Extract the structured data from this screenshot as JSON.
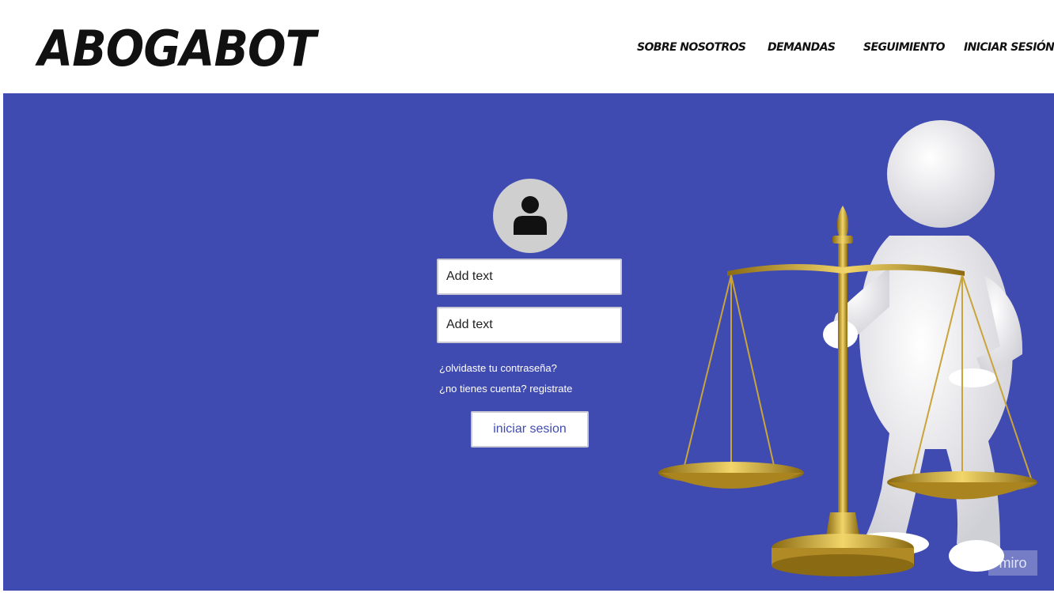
{
  "header": {
    "logo": "ABOGABOT",
    "nav": [
      {
        "label": "SOBRE NOSOTROS"
      },
      {
        "label": "DEMANDAS"
      },
      {
        "label": "SEGUIMIENTO"
      },
      {
        "label": "INICIAR SESIÓN"
      }
    ]
  },
  "login": {
    "avatar_icon": "user-icon",
    "field1_placeholder": "Add text",
    "field2_placeholder": "Add text",
    "forgot_link": "¿olvidaste tu contraseña?",
    "register_link": "¿no tienes cuenta? registrate",
    "submit_label": "iniciar sesion"
  },
  "watermark": "miro",
  "colors": {
    "hero_background": "#404bb2",
    "header_background": "#ffffff",
    "button_text": "#404bb2",
    "avatar_background": "#cfcfcf",
    "scale_gold": "#c9a43a"
  }
}
